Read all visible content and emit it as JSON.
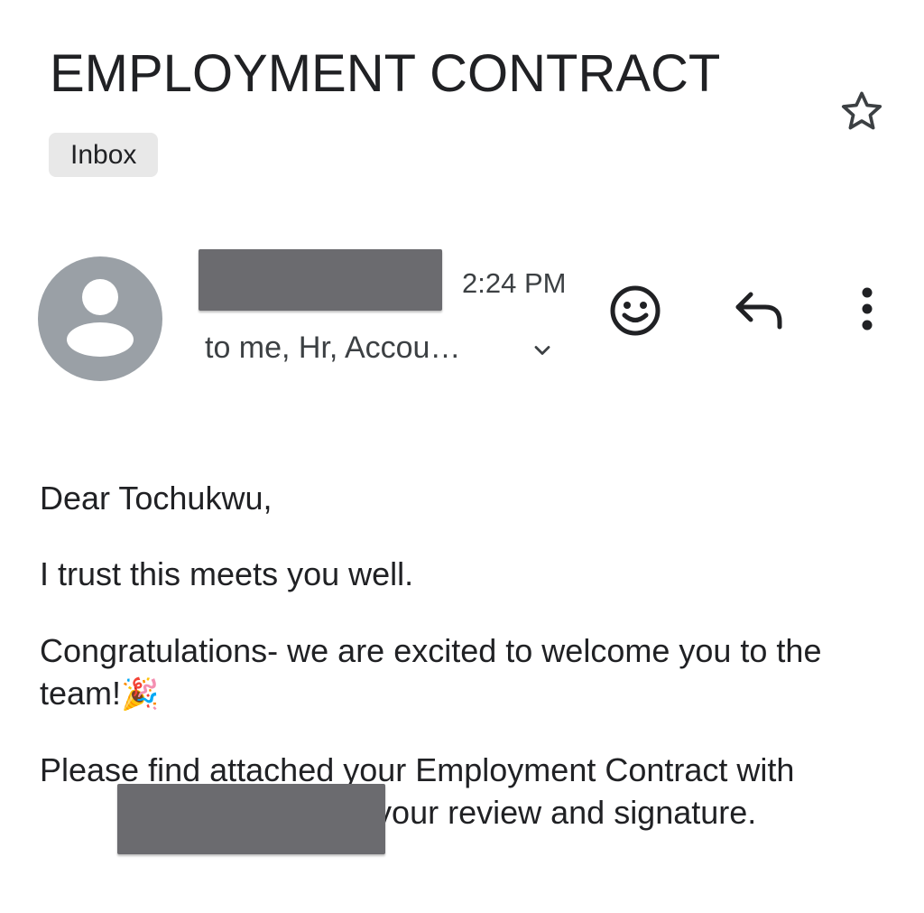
{
  "email": {
    "subject": "EMPLOYMENT CONTRACT",
    "label": "Inbox",
    "time": "2:24 PM",
    "recipients": "to me, Hr, Accou…",
    "body": {
      "greeting": "Dear Tochukwu,",
      "line1": "I trust this meets you well.",
      "line2": "Congratulations- we are excited to welcome you to the team!",
      "line2_emoji": "🎉",
      "line3_start": "Please find attached your Employment Contract with",
      "line3_end": "ed for your review and signature."
    }
  },
  "icons": {
    "star": "star-outline-icon",
    "avatar": "person-icon",
    "chevron": "chevron-down-icon",
    "react": "emoji-smile-icon",
    "reply": "reply-icon",
    "more": "more-vert-icon"
  },
  "colors": {
    "text": "#202124",
    "secondary_text": "#3c4043",
    "avatar_bg": "#9aa0a6",
    "chip_bg": "#e8e8e8",
    "redaction": "#6b6b6f"
  }
}
